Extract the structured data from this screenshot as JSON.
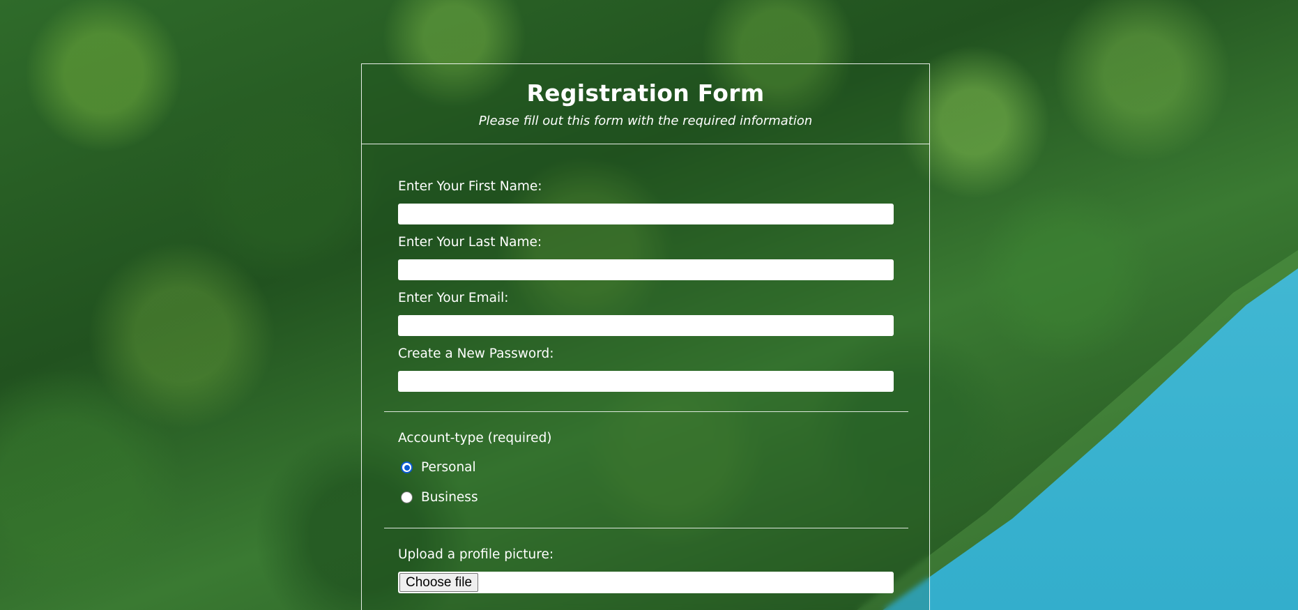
{
  "form": {
    "title": "Registration Form",
    "subtitle": "Please fill out this form with the required information",
    "fields": [
      {
        "label": "Enter Your First Name:",
        "value": ""
      },
      {
        "label": "Enter Your Last Name:",
        "value": ""
      },
      {
        "label": "Enter Your Email:",
        "value": ""
      },
      {
        "label": "Create a New Password:",
        "value": ""
      }
    ],
    "account_type": {
      "label": "Account-type (required)",
      "options": [
        {
          "label": "Personal",
          "checked": true
        },
        {
          "label": "Business",
          "checked": false
        }
      ]
    },
    "upload": {
      "label": "Upload a profile picture:",
      "button_label": "Choose file"
    }
  },
  "colors": {
    "radio_accent": "#0b5bd3",
    "text": "#ffffff",
    "water": "#3fb6d2",
    "forest": "#2f6b2a"
  }
}
